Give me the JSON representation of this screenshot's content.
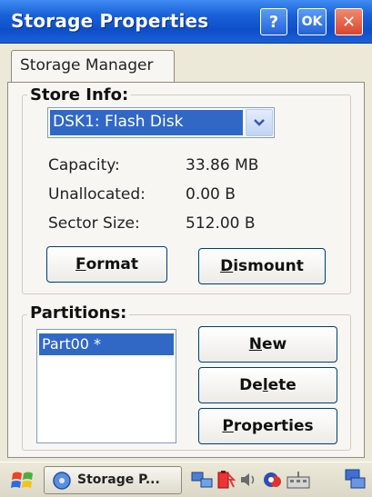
{
  "window": {
    "title": "Storage Properties",
    "help_label": "?",
    "ok_label": "OK",
    "close_label": "✕"
  },
  "tabs": [
    {
      "label": "Storage Manager",
      "selected": true
    }
  ],
  "store_info": {
    "heading": "Store Info:",
    "store_selected": "DSK1: Flash Disk",
    "capacity_label": "Capacity:",
    "capacity_value": "33.86 MB",
    "unallocated_label": "Unallocated:",
    "unallocated_value": "0.00 B",
    "sector_label": "Sector Size:",
    "sector_value": "512.00 B",
    "format_mnemonic": "F",
    "format_rest": "ormat",
    "dismount_mnemonic": "D",
    "dismount_rest": "ismount"
  },
  "partitions": {
    "heading": "Partitions:",
    "items": [
      {
        "label": "Part00 *",
        "selected": true
      }
    ],
    "new_mnemonic": "N",
    "new_rest": "ew",
    "delete_pre": "De",
    "delete_mnemonic": "l",
    "delete_rest": "ete",
    "properties_mnemonic": "P",
    "properties_rest": "roperties"
  },
  "taskbar": {
    "task_label": "Storage P..."
  },
  "colors": {
    "titlebar": "#1a61d8",
    "selection": "#3168c6",
    "close": "#d9452b"
  }
}
